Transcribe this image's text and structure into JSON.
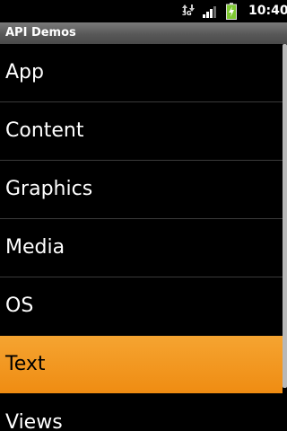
{
  "status_bar": {
    "network_label": "3G",
    "clock": "10:40",
    "icons": [
      "network-activity-icon",
      "signal-strength-icon",
      "battery-charging-icon"
    ]
  },
  "title_bar": {
    "title": "API Demos"
  },
  "list": {
    "items": [
      {
        "label": "App"
      },
      {
        "label": "Content"
      },
      {
        "label": "Graphics"
      },
      {
        "label": "Media"
      },
      {
        "label": "OS"
      },
      {
        "label": "Text",
        "selected": true
      },
      {
        "label": "Views"
      }
    ]
  },
  "colors": {
    "background": "#000000",
    "selected_highlight": "#f0931c",
    "title_bar": "#5a5a5a",
    "battery_green": "#7ec832"
  }
}
